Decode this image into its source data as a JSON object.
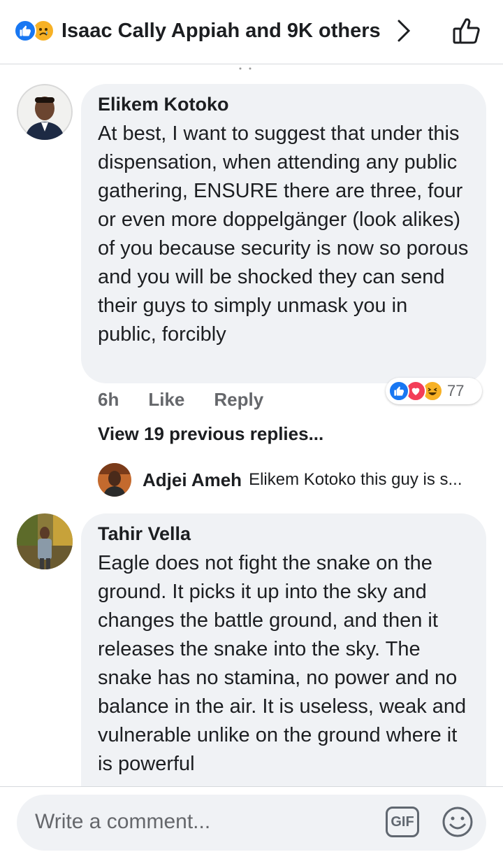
{
  "header": {
    "reactors_text": "Isaac Cally Appiah and 9K others"
  },
  "comments": [
    {
      "author": "Elikem Kotoko",
      "text": "At best, I want to suggest that under this dispensation, when attending any public gathering, ENSURE there are three, four or even more doppelgänger (look alikes) of you because security is now so porous and you will be shocked they can send their guys to simply unmask you in public, forcibly",
      "time": "6h",
      "like_label": "Like",
      "reply_label": "Reply",
      "reaction_count": "77"
    },
    {
      "author": "Tahir Vella",
      "text": "Eagle does not fight the snake on the ground. It picks it up into the sky and changes the battle ground, and then it releases the snake into the sky. The snake has no stamina, no power and no balance in the air. It is useless, weak and vulnerable unlike on the ground where it is powerful"
    }
  ],
  "view_previous_replies": "View 19 previous replies...",
  "reply_preview": {
    "author": "Adjei Ameh",
    "text": "Elikem Kotoko this guy is s..."
  },
  "composer": {
    "placeholder": "Write a comment...",
    "gif_label": "GIF"
  },
  "colors": {
    "like_blue": "#1877f2",
    "love_red": "#f33e58",
    "haha_yellow": "#f7b125",
    "bubble_bg": "#f0f2f5",
    "muted_text": "#65676b"
  }
}
